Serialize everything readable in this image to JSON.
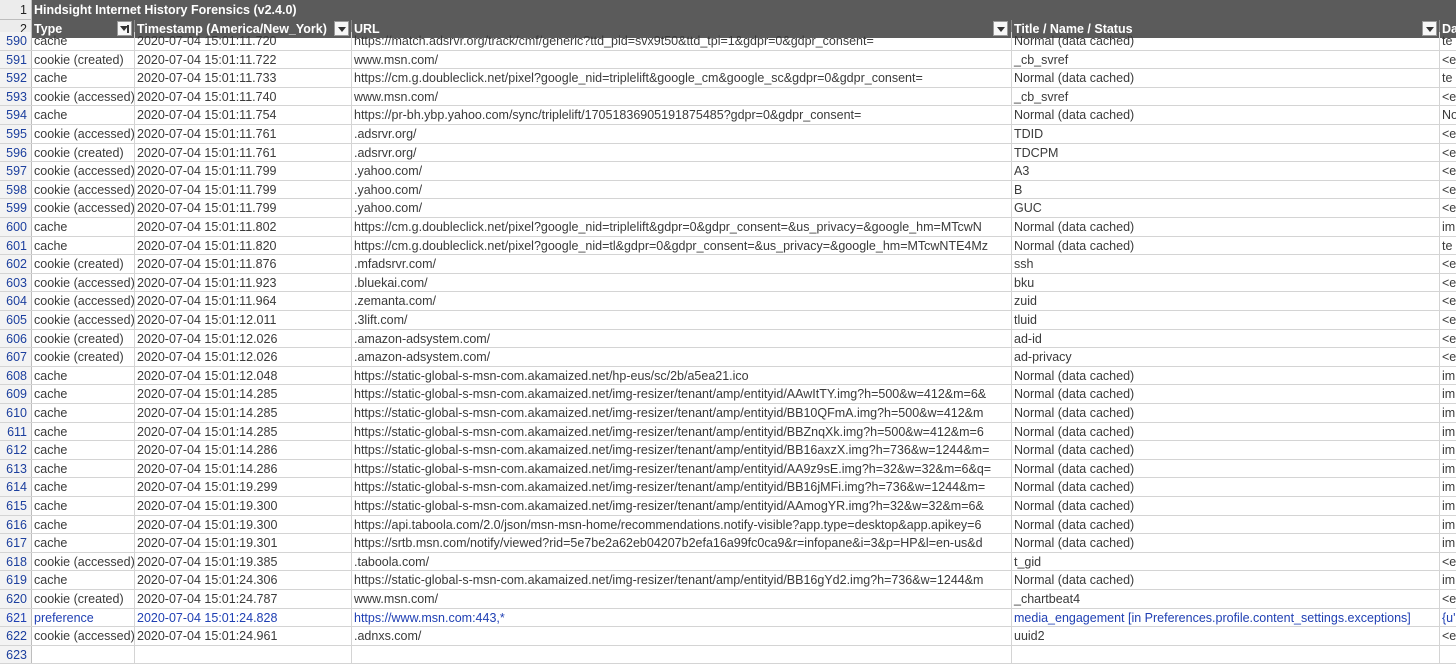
{
  "sheet": {
    "title": "Hindsight Internet History Forensics (v2.4.0)",
    "title_row_num": "1",
    "header_row_num": "2",
    "columns": [
      "Type",
      "Timestamp (America/New_York)",
      "URL",
      "Title / Name / Status",
      "Da"
    ],
    "rows": [
      {
        "n": "590",
        "type": "cache",
        "ts": "2020-07-04 15:01:11.720",
        "url": "https://match.adsrvr.org/track/cmf/generic?ttd_pid=svx9t50&ttd_tpi=1&gdpr=0&gdpr_consent=",
        "title": "Normal (data cached)",
        "data": "te"
      },
      {
        "n": "591",
        "type": "cookie (created)",
        "ts": "2020-07-04 15:01:11.722",
        "url": "www.msn.com/",
        "title": "_cb_svref",
        "data": "<e"
      },
      {
        "n": "592",
        "type": "cache",
        "ts": "2020-07-04 15:01:11.733",
        "url": "https://cm.g.doubleclick.net/pixel?google_nid=triplelift&google_cm&google_sc&gdpr=0&gdpr_consent=",
        "title": "Normal (data cached)",
        "data": "te"
      },
      {
        "n": "593",
        "type": "cookie (accessed)",
        "ts": "2020-07-04 15:01:11.740",
        "url": "www.msn.com/",
        "title": "_cb_svref",
        "data": "<e"
      },
      {
        "n": "594",
        "type": "cache",
        "ts": "2020-07-04 15:01:11.754",
        "url": "https://pr-bh.ybp.yahoo.com/sync/triplelift/17051836905191875485?gdpr=0&gdpr_consent=",
        "title": "Normal (data cached)",
        "data": "No"
      },
      {
        "n": "595",
        "type": "cookie (accessed)",
        "ts": "2020-07-04 15:01:11.761",
        "url": ".adsrvr.org/",
        "title": "TDID",
        "data": "<e"
      },
      {
        "n": "596",
        "type": "cookie (created)",
        "ts": "2020-07-04 15:01:11.761",
        "url": ".adsrvr.org/",
        "title": "TDCPM",
        "data": "<e"
      },
      {
        "n": "597",
        "type": "cookie (accessed)",
        "ts": "2020-07-04 15:01:11.799",
        "url": ".yahoo.com/",
        "title": "A3",
        "data": "<e"
      },
      {
        "n": "598",
        "type": "cookie (accessed)",
        "ts": "2020-07-04 15:01:11.799",
        "url": ".yahoo.com/",
        "title": "B",
        "data": "<e"
      },
      {
        "n": "599",
        "type": "cookie (accessed)",
        "ts": "2020-07-04 15:01:11.799",
        "url": ".yahoo.com/",
        "title": "GUC",
        "data": "<e"
      },
      {
        "n": "600",
        "type": "cache",
        "ts": "2020-07-04 15:01:11.802",
        "url": "https://cm.g.doubleclick.net/pixel?google_nid=triplelift&gdpr=0&gdpr_consent=&us_privacy=&google_hm=MTcwN",
        "title": "Normal (data cached)",
        "data": "im"
      },
      {
        "n": "601",
        "type": "cache",
        "ts": "2020-07-04 15:01:11.820",
        "url": "https://cm.g.doubleclick.net/pixel?google_nid=tl&gdpr=0&gdpr_consent=&us_privacy=&google_hm=MTcwNTE4Mz",
        "title": "Normal (data cached)",
        "data": "te"
      },
      {
        "n": "602",
        "type": "cookie (created)",
        "ts": "2020-07-04 15:01:11.876",
        "url": ".mfadsrvr.com/",
        "title": "ssh",
        "data": "<e"
      },
      {
        "n": "603",
        "type": "cookie (accessed)",
        "ts": "2020-07-04 15:01:11.923",
        "url": ".bluekai.com/",
        "title": "bku",
        "data": "<e"
      },
      {
        "n": "604",
        "type": "cookie (accessed)",
        "ts": "2020-07-04 15:01:11.964",
        "url": ".zemanta.com/",
        "title": "zuid",
        "data": "<e"
      },
      {
        "n": "605",
        "type": "cookie (accessed)",
        "ts": "2020-07-04 15:01:12.011",
        "url": ".3lift.com/",
        "title": "tluid",
        "data": "<e"
      },
      {
        "n": "606",
        "type": "cookie (created)",
        "ts": "2020-07-04 15:01:12.026",
        "url": ".amazon-adsystem.com/",
        "title": "ad-id",
        "data": "<e"
      },
      {
        "n": "607",
        "type": "cookie (created)",
        "ts": "2020-07-04 15:01:12.026",
        "url": ".amazon-adsystem.com/",
        "title": "ad-privacy",
        "data": "<e"
      },
      {
        "n": "608",
        "type": "cache",
        "ts": "2020-07-04 15:01:12.048",
        "url": "https://static-global-s-msn-com.akamaized.net/hp-eus/sc/2b/a5ea21.ico",
        "title": "Normal (data cached)",
        "data": "im"
      },
      {
        "n": "609",
        "type": "cache",
        "ts": "2020-07-04 15:01:14.285",
        "url": "https://static-global-s-msn-com.akamaized.net/img-resizer/tenant/amp/entityid/AAwItTY.img?h=500&w=412&m=6&",
        "title": "Normal (data cached)",
        "data": "im"
      },
      {
        "n": "610",
        "type": "cache",
        "ts": "2020-07-04 15:01:14.285",
        "url": "https://static-global-s-msn-com.akamaized.net/img-resizer/tenant/amp/entityid/BB10QFmA.img?h=500&w=412&m",
        "title": "Normal (data cached)",
        "data": "im"
      },
      {
        "n": "611",
        "type": "cache",
        "ts": "2020-07-04 15:01:14.285",
        "url": "https://static-global-s-msn-com.akamaized.net/img-resizer/tenant/amp/entityid/BBZnqXk.img?h=500&w=412&m=6",
        "title": "Normal (data cached)",
        "data": "im"
      },
      {
        "n": "612",
        "type": "cache",
        "ts": "2020-07-04 15:01:14.286",
        "url": "https://static-global-s-msn-com.akamaized.net/img-resizer/tenant/amp/entityid/BB16axzX.img?h=736&w=1244&m=",
        "title": "Normal (data cached)",
        "data": "im"
      },
      {
        "n": "613",
        "type": "cache",
        "ts": "2020-07-04 15:01:14.286",
        "url": "https://static-global-s-msn-com.akamaized.net/img-resizer/tenant/amp/entityid/AA9z9sE.img?h=32&w=32&m=6&q=",
        "title": "Normal (data cached)",
        "data": "im"
      },
      {
        "n": "614",
        "type": "cache",
        "ts": "2020-07-04 15:01:19.299",
        "url": "https://static-global-s-msn-com.akamaized.net/img-resizer/tenant/amp/entityid/BB16jMFi.img?h=736&w=1244&m=",
        "title": "Normal (data cached)",
        "data": "im"
      },
      {
        "n": "615",
        "type": "cache",
        "ts": "2020-07-04 15:01:19.300",
        "url": "https://static-global-s-msn-com.akamaized.net/img-resizer/tenant/amp/entityid/AAmogYR.img?h=32&w=32&m=6&",
        "title": "Normal (data cached)",
        "data": "im"
      },
      {
        "n": "616",
        "type": "cache",
        "ts": "2020-07-04 15:01:19.300",
        "url": "https://api.taboola.com/2.0/json/msn-msn-home/recommendations.notify-visible?app.type=desktop&app.apikey=6",
        "title": "Normal (data cached)",
        "data": "im"
      },
      {
        "n": "617",
        "type": "cache",
        "ts": "2020-07-04 15:01:19.301",
        "url": "https://srtb.msn.com/notify/viewed?rid=5e7be2a62eb04207b2efa16a99fc0ca9&r=infopane&i=3&p=HP&l=en-us&d",
        "title": "Normal (data cached)",
        "data": "im"
      },
      {
        "n": "618",
        "type": "cookie (accessed)",
        "ts": "2020-07-04 15:01:19.385",
        "url": ".taboola.com/",
        "title": "t_gid",
        "data": "<e"
      },
      {
        "n": "619",
        "type": "cache",
        "ts": "2020-07-04 15:01:24.306",
        "url": "https://static-global-s-msn-com.akamaized.net/img-resizer/tenant/amp/entityid/BB16gYd2.img?h=736&w=1244&m",
        "title": "Normal (data cached)",
        "data": "im"
      },
      {
        "n": "620",
        "type": "cookie (created)",
        "ts": "2020-07-04 15:01:24.787",
        "url": "www.msn.com/",
        "title": "_chartbeat4",
        "data": "<e"
      },
      {
        "n": "621",
        "type": "preference",
        "ts": "2020-07-04 15:01:24.828",
        "url": "https://www.msn.com:443,*",
        "title": "media_engagement [in Preferences.profile.content_settings.exceptions]",
        "data": "{u'",
        "pref": true
      },
      {
        "n": "622",
        "type": "cookie (accessed)",
        "ts": "2020-07-04 15:01:24.961",
        "url": ".adnxs.com/",
        "title": "uuid2",
        "data": "<e"
      },
      {
        "n": "623",
        "type": "",
        "ts": "",
        "url": "",
        "title": "",
        "data": ""
      }
    ]
  }
}
